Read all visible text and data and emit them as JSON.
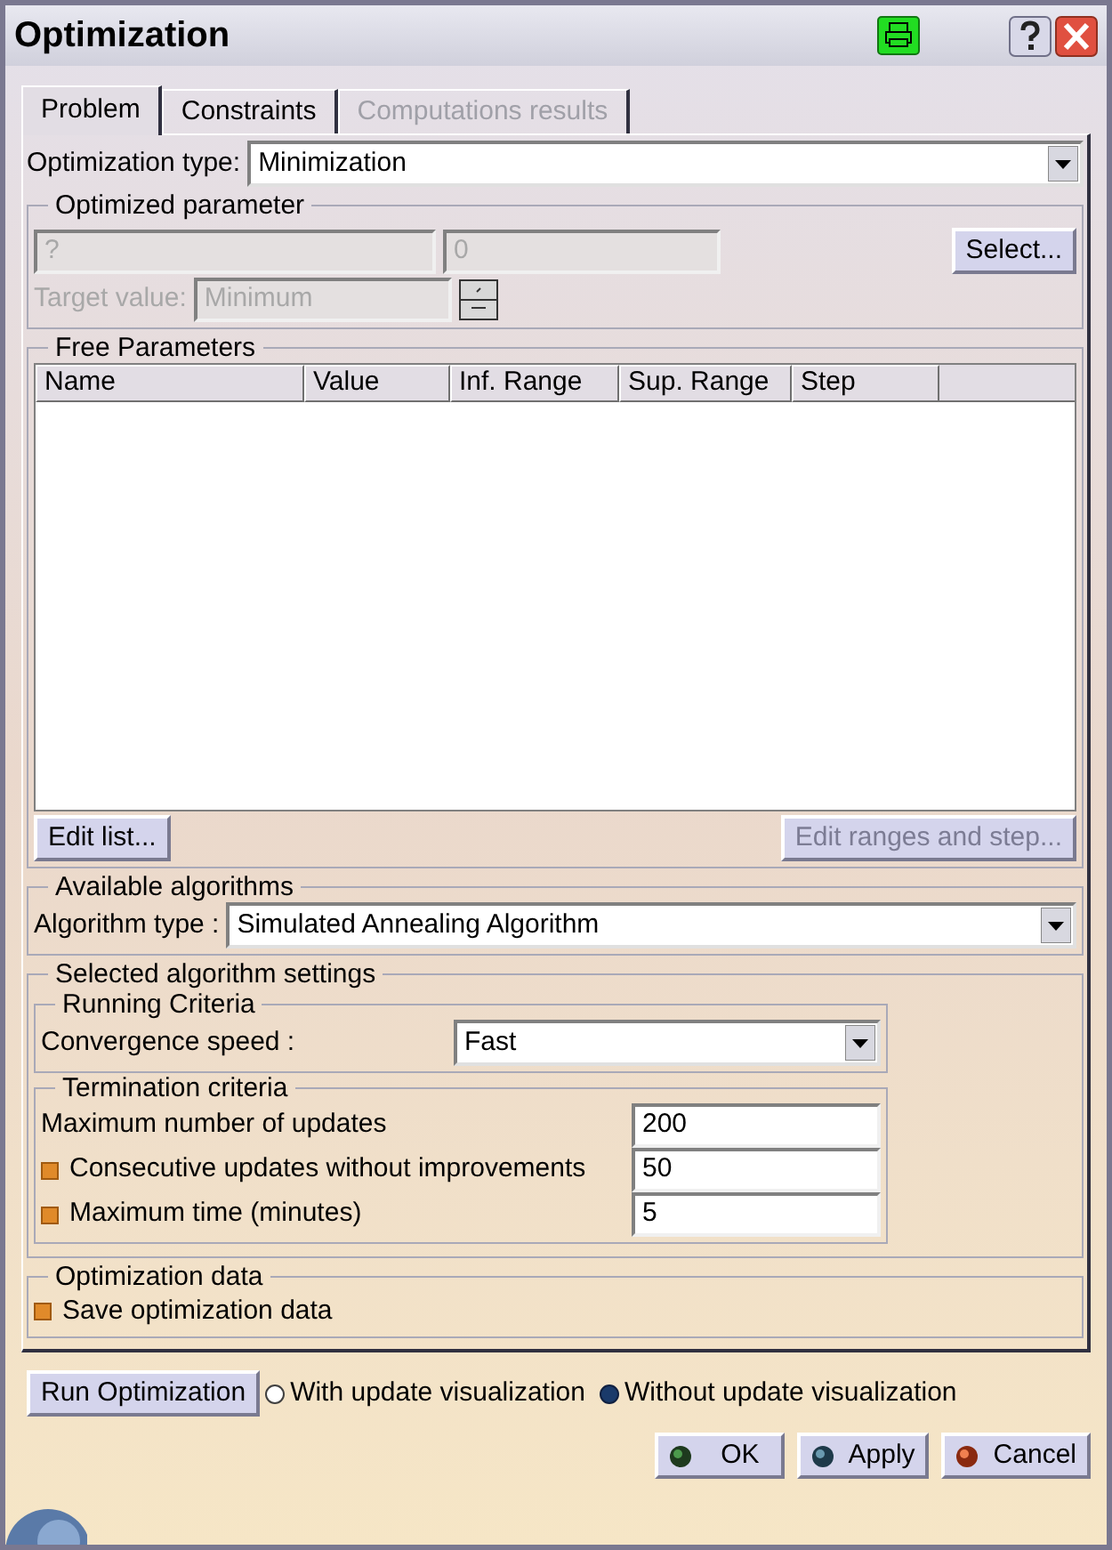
{
  "window": {
    "title": "Optimization"
  },
  "tabs": [
    {
      "label": "Problem",
      "selected": true,
      "disabled": false
    },
    {
      "label": "Constraints",
      "selected": false,
      "disabled": false
    },
    {
      "label": "Computations results",
      "selected": false,
      "disabled": true
    }
  ],
  "optimization_type": {
    "label": "Optimization type:",
    "value": "Minimization"
  },
  "optimized_parameter": {
    "title": "Optimized parameter",
    "disabled": true,
    "parameter": "?",
    "value": "0",
    "select_button": "Select...",
    "target_label": "Target value:",
    "target_value": "Minimum"
  },
  "free_parameters": {
    "title": "Free Parameters",
    "columns": [
      "Name",
      "Value",
      "Inf. Range",
      "Sup. Range",
      "Step"
    ],
    "edit_list_button": {
      "label": "Edit list...",
      "disabled": false
    },
    "edit_ranges_button": {
      "label": "Edit ranges and step...",
      "disabled": true
    }
  },
  "available_algorithms": {
    "title": "Available algorithms",
    "label": "Algorithm type :",
    "value": "Simulated Annealing Algorithm"
  },
  "algorithm_settings": {
    "title": "Selected algorithm settings",
    "running_criteria": {
      "title": "Running Criteria",
      "label": "Convergence speed :",
      "value": "Fast"
    },
    "termination_criteria": {
      "title": "Termination criteria",
      "rows": [
        {
          "kind": "plain",
          "label": "Maximum number of updates",
          "value": "200"
        },
        {
          "kind": "checkbox",
          "checked": true,
          "label": "Consecutive updates without improvements",
          "value": "50"
        },
        {
          "kind": "checkbox",
          "checked": true,
          "label": "Maximum time (minutes)",
          "value": "5"
        }
      ]
    }
  },
  "optimization_data": {
    "title": "Optimization data",
    "options": [
      {
        "label": "Save optimization data",
        "checked": true
      }
    ]
  },
  "run_button": "Run Optimization",
  "visualization": [
    {
      "label": "With update visualization",
      "selected": false
    },
    {
      "label": "Without update visualization",
      "selected": true
    }
  ],
  "buttons": [
    {
      "kind": "ok",
      "label": "OK"
    },
    {
      "kind": "apply",
      "label": "Apply"
    },
    {
      "kind": "cancel",
      "label": "Cancel"
    }
  ]
}
